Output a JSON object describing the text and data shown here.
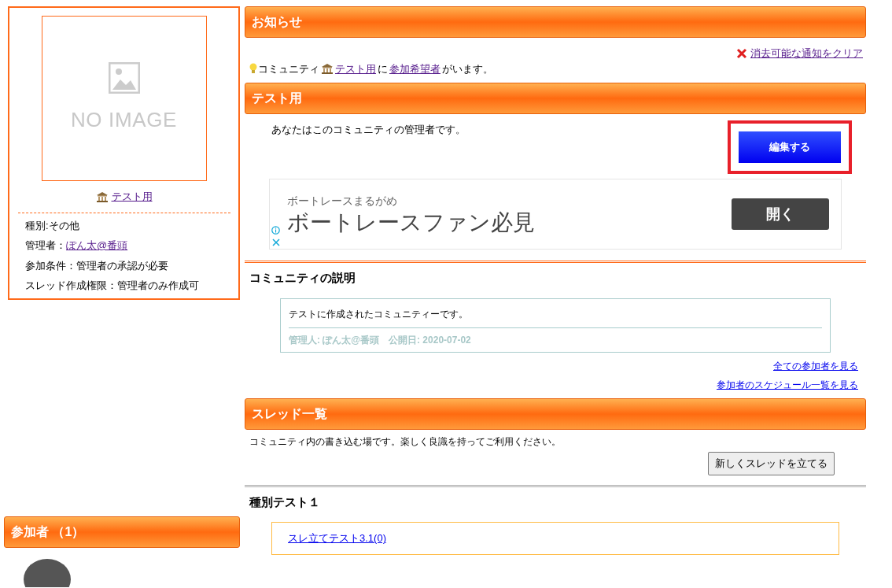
{
  "sidebar": {
    "image_placeholder": "NO IMAGE",
    "community_link": "テスト用",
    "details": [
      {
        "label": "種別: ",
        "value": "その他",
        "kind": "text"
      },
      {
        "label": "管理者： ",
        "value": "ぽん太@番頭",
        "kind": "link"
      },
      {
        "label": "参加条件： ",
        "value": "管理者の承認が必要",
        "kind": "text"
      },
      {
        "label": "スレッド作成権限： ",
        "value": "管理者のみ作成可",
        "kind": "text"
      }
    ],
    "members": {
      "title": "参加者 （1）"
    }
  },
  "notices": {
    "title": "お知らせ",
    "clear_link": "消去可能な通知をクリア",
    "message": {
      "before": "コミュニティ",
      "link1": "テスト用",
      "middle": "に",
      "link2": "参加希望者",
      "after": "がいます。"
    }
  },
  "community": {
    "title": "テスト用",
    "admin_note": "あなたはこのコミュニティの管理者です。",
    "edit_button": "編集する",
    "edit_highlighted": true
  },
  "ad": {
    "sponsor": "ボートレースまるがめ",
    "headline": "ボートレースファン必見",
    "button": "開く"
  },
  "description": {
    "title": "コミュニティの説明",
    "text": "テストに作成されたコミュニティーです。",
    "meta": "管理人: ぽん太@番頭　公開日: 2020-07-02",
    "links": [
      "全ての参加者を見る",
      "参加者のスケジュール一覧を見る"
    ]
  },
  "threads": {
    "title": "スレッド一覧",
    "intro": "コミュニティ内の書き込む場です。楽しく良識を持ってご利用ください。",
    "new_button": "新しくスレッドを立てる",
    "categories": [
      {
        "title": "種別テスト１",
        "items": [
          "スレ立てテスト3.1(0)"
        ]
      }
    ]
  }
}
